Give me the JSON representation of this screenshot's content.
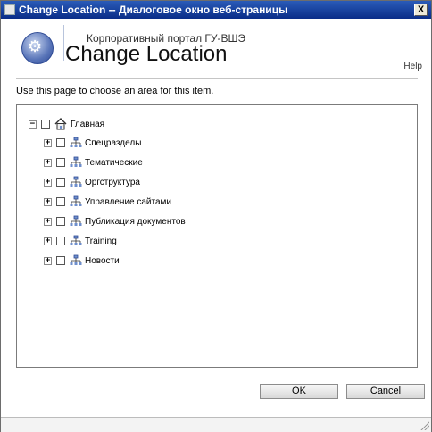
{
  "window": {
    "title": "Change Location -- Диалоговое окно веб-страницы",
    "close_label": "X"
  },
  "header": {
    "portal_name": "Корпоративный портал ГУ-ВШЭ",
    "page_title": "Change Location",
    "help_label": "Help"
  },
  "main": {
    "instructions": "Use this page to choose an area for this item.",
    "tree": {
      "root": {
        "label": "Главная",
        "expander": "−",
        "icon": "home-icon"
      },
      "children": [
        {
          "label": "Спецразделы",
          "expander": "+",
          "icon": "site-hierarchy-icon"
        },
        {
          "label": "Тематические",
          "expander": "+",
          "icon": "site-hierarchy-icon"
        },
        {
          "label": "Оргструктура",
          "expander": "+",
          "icon": "site-hierarchy-icon"
        },
        {
          "label": "Управление сайтами",
          "expander": "+",
          "icon": "site-hierarchy-icon"
        },
        {
          "label": "Публикация документов",
          "expander": "+",
          "icon": "site-hierarchy-icon"
        },
        {
          "label": "Training",
          "expander": "+",
          "icon": "site-hierarchy-icon"
        },
        {
          "label": "Новости",
          "expander": "+",
          "icon": "site-hierarchy-icon"
        }
      ]
    }
  },
  "buttons": {
    "ok_label": "OK",
    "cancel_label": "Cancel"
  },
  "colors": {
    "titlebar": "#0a2d88",
    "text": "#000000",
    "logo": "#5874b8"
  }
}
